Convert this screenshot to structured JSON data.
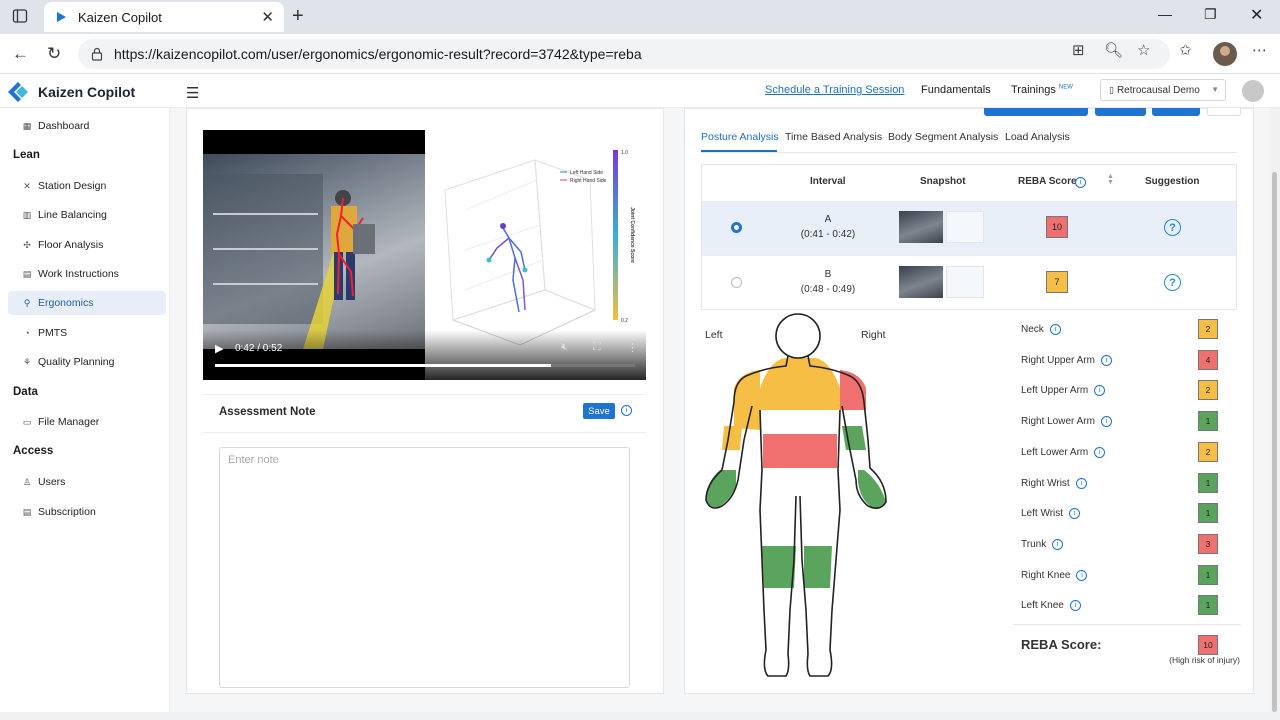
{
  "browser": {
    "tab_title": "Kaizen Copilot",
    "url": "https://kaizencopilot.com/user/ergonomics/ergonomic-result?record=3742&type=reba"
  },
  "header": {
    "app_name": "Kaizen Copilot",
    "schedule_link": "Schedule a Training Session",
    "fundamentals": "Fundamentals",
    "trainings": "Trainings",
    "trainings_badge": "NEW",
    "org": "Retrocausal Demo"
  },
  "sidebar": {
    "dashboard": "Dashboard",
    "lean": "Lean",
    "station_design": "Station Design",
    "line_balancing": "Line Balancing",
    "floor_analysis": "Floor Analysis",
    "work_instructions": "Work Instructions",
    "ergonomics": "Ergonomics",
    "pmts": "PMTS",
    "quality_planning": "Quality Planning",
    "data": "Data",
    "file_manager": "File Manager",
    "access": "Access",
    "users": "Users",
    "subscription": "Subscription"
  },
  "video": {
    "time": "0:42 / 0:52",
    "progress": 0.8
  },
  "assessment": {
    "title": "Assessment Note",
    "save": "Save",
    "placeholder": "Enter note"
  },
  "analysis_tabs": {
    "posture": "Posture Analysis",
    "time_based": "Time Based Analysis",
    "body_segment": "Body Segment Analysis",
    "load": "Load Analysis"
  },
  "table": {
    "col_interval": "Interval",
    "col_snapshot": "Snapshot",
    "col_reba": "REBA Score",
    "col_suggestion": "Suggestion",
    "rows": [
      {
        "label": "A",
        "range": "(0:41 - 0:42)",
        "score": "10",
        "color": "#f07070"
      },
      {
        "label": "B",
        "range": "(0:48 - 0:49)",
        "score": "7",
        "color": "#f7be45"
      }
    ]
  },
  "body_view": {
    "left": "Left",
    "right": "Right"
  },
  "segments": [
    {
      "name": "Neck",
      "score": "2",
      "color": "#f7be45"
    },
    {
      "name": "Right Upper Arm",
      "score": "4",
      "color": "#f07070"
    },
    {
      "name": "Left Upper Arm",
      "score": "2",
      "color": "#f7be45"
    },
    {
      "name": "Right Lower Arm",
      "score": "1",
      "color": "#5aa45e"
    },
    {
      "name": "Left Lower Arm",
      "score": "2",
      "color": "#f7be45"
    },
    {
      "name": "Right Wrist",
      "score": "1",
      "color": "#5aa45e"
    },
    {
      "name": "Left Wrist",
      "score": "1",
      "color": "#5aa45e"
    },
    {
      "name": "Trunk",
      "score": "3",
      "color": "#f07070"
    },
    {
      "name": "Right Knee",
      "score": "1",
      "color": "#5aa45e"
    },
    {
      "name": "Left Knee",
      "score": "1",
      "color": "#5aa45e"
    }
  ],
  "reba_total": {
    "label": "REBA Score:",
    "score": "10",
    "color": "#f07070",
    "risk": "(High risk of injury)"
  },
  "plot_legend": {
    "left_hand": "Left Hand Side",
    "right_hand": "Right Hand Side",
    "colorbar_label": "Joint Confidence Score",
    "cb_top": "1.0",
    "cb_bottom": "0.2"
  },
  "colors": {
    "accent": "#1f73d1",
    "high": "#f07070",
    "medium": "#f7be45",
    "low": "#5aa45e"
  }
}
